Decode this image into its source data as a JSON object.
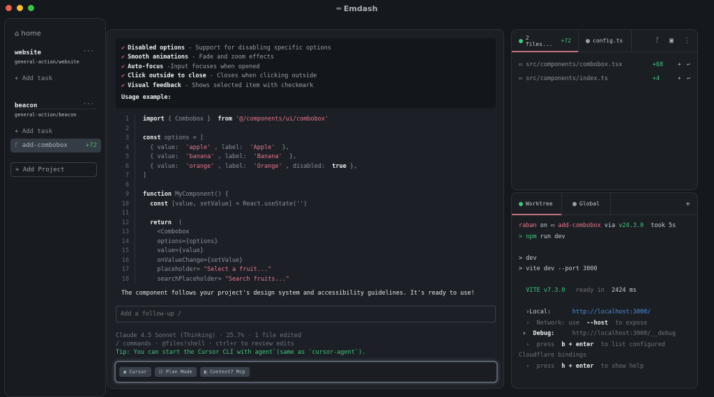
{
  "app": {
    "title": "Emdash"
  },
  "sidebar": {
    "home": "home",
    "projects": [
      {
        "name": "website",
        "path": "general-action/website",
        "add_task": "Add task"
      },
      {
        "name": "beacon",
        "path": "general-action/beacon",
        "add_task": "Add task"
      }
    ],
    "branch": {
      "name": "add-combobox",
      "count": "+72"
    },
    "add_project": "Add Project"
  },
  "features": [
    {
      "title": "Disabled options",
      "desc": " - Support for disabling specific options"
    },
    {
      "title": "Smooth animations",
      "desc": " - Fade and zoom effects"
    },
    {
      "title": "Auto-focus",
      "desc": " -Input focuses when opened"
    },
    {
      "title": "Click outside to close",
      "desc": " - Closes when clicking outside"
    },
    {
      "title": "Visual feedback",
      "desc": " - Shows selected item with checkmark"
    }
  ],
  "usage_label": "Usage example:",
  "code": [
    [
      [
        "kw",
        "import "
      ],
      [
        "pl",
        "{ Combobox }  "
      ],
      [
        "kw",
        "from "
      ],
      [
        "st",
        "'@/components/ui/combobox'"
      ]
    ],
    [],
    [
      [
        "kw",
        "const "
      ],
      [
        "pl",
        "options = ["
      ]
    ],
    [
      [
        "pl",
        "  { value:  "
      ],
      [
        "st",
        "'apple'"
      ],
      [
        "pl",
        " , label:  "
      ],
      [
        "st",
        "'Apple'"
      ],
      [
        "pl",
        "  },"
      ]
    ],
    [
      [
        "pl",
        "  { value:  "
      ],
      [
        "st",
        "'banana'"
      ],
      [
        "pl",
        " , label:  "
      ],
      [
        "st",
        "'Banana'"
      ],
      [
        "pl",
        "  },"
      ]
    ],
    [
      [
        "pl",
        "  { value:  "
      ],
      [
        "st",
        "'orange'"
      ],
      [
        "pl",
        " , label:  "
      ],
      [
        "st",
        "'Orange'"
      ],
      [
        "pl",
        " , disabled:  "
      ],
      [
        "kw",
        "true"
      ],
      [
        "pl",
        " },"
      ]
    ],
    [
      [
        "pl",
        "]"
      ]
    ],
    [],
    [
      [
        "kw",
        "function "
      ],
      [
        "pl",
        "MyComponent() {"
      ]
    ],
    [
      [
        "kw",
        "  const "
      ],
      [
        "pl",
        "[value, setValue] = React.useState('')"
      ]
    ],
    [],
    [
      [
        "kw",
        "  return "
      ],
      [
        "pl",
        " ("
      ]
    ],
    [
      [
        "pl",
        "    <Combobox"
      ]
    ],
    [
      [
        "pl",
        "    options={options}"
      ]
    ],
    [
      [
        "pl",
        "    value={value}"
      ]
    ],
    [
      [
        "pl",
        "    onValueChange={setValue}"
      ]
    ],
    [
      [
        "pl",
        "    placeholder= "
      ],
      [
        "st",
        "\"Select a fruit...\""
      ]
    ],
    [
      [
        "pl",
        "    searchPlaceholder= "
      ],
      [
        "st",
        "\"Search fruits...\""
      ]
    ]
  ],
  "message": "The component follows your project's design system and accessibility guidelines. It's ready to use!",
  "followup": {
    "placeholder": "Add a follow-up /"
  },
  "meta": {
    "line1": "Claude 4.5 Sonnet (Thinking) · 25.7% · 1 file edited",
    "line2": "/ commands · @files!shell · ctrl+r to review edits",
    "tip": "Tip: You can start the Cursor CLI with agent`(same as `cursor-agent`)."
  },
  "chips": [
    {
      "label": "Cursor"
    },
    {
      "label": "Plan Mode"
    },
    {
      "label": "Context7 Mcp"
    }
  ],
  "changes": {
    "tab_label": "2 files...",
    "tab_count": "+72",
    "tab2": "config.ts",
    "files": [
      {
        "path": "src/components/combobox.tsx",
        "add": "+68"
      },
      {
        "path": "src/components/index.ts",
        "add": "+4"
      }
    ]
  },
  "terminal": {
    "tab1": "Worktree",
    "tab2": "Global",
    "user": "raban",
    "on": " on ",
    "branch": "add-combobox",
    "via": " via ",
    "node": "v24.3.0",
    "took": "  took 5s",
    "prompt": "> ",
    "cmd1": "npm",
    "cmd2": " run dev",
    "out1": "> dev",
    "out2": "> vite dev --port 3000",
    "vite": "VITE v7.3.0",
    "ready": "   ready in  ",
    "ms": "2424",
    "ms_unit": " ms",
    "local_label": "›Local:      ",
    "local_url": "http://localhost:3000/",
    "network": "  ›  Network: use  ",
    "host": "--host",
    "expose": "  to expose",
    "debug_label": " ›  Debug:     ",
    "debug_url": "http://localhost:3000/__debug",
    "press": "  ›  press  ",
    "b": "b + enter",
    "list": "  to list configured",
    "cf": "Cloudflare bindings",
    "h": "h + enter",
    "help": "  to show help"
  }
}
